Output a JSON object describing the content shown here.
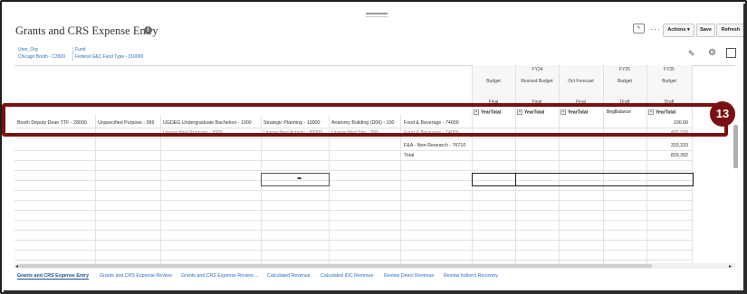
{
  "title": "Grants and CRS Expense Entry",
  "toolbar": {
    "actions_label": "Actions ▾",
    "save_label": "Save",
    "refresh_label": "Refresh"
  },
  "pov": [
    {
      "label": "User_Org",
      "value": "Chicago Booth - C3500"
    },
    {
      "label": "Fund",
      "value": "Federal G&C Fund Type - 310000"
    }
  ],
  "grid": {
    "columns": [
      {
        "period": "",
        "scenario": "Budget",
        "version": "Final",
        "member": "YearTotal"
      },
      {
        "period": "FY24",
        "scenario": "Revised Budget",
        "version": "Final",
        "member": "YearTotal"
      },
      {
        "period": "",
        "scenario": "Oct Forecast",
        "version": "Final",
        "member": "YearTotal"
      },
      {
        "period": "FY25",
        "scenario": "Budget",
        "version": "Draft",
        "member": "BegBalance"
      },
      {
        "period": "FY25",
        "scenario": "Budget",
        "version": "Draft",
        "member": "YearTotal"
      }
    ],
    "highlight_row": {
      "cells": [
        "Booth Deputy Dean TTF - 28000",
        "Unspecified Purpose - 999",
        "UGDEG Undergraduate Bachelors - 1000",
        "Strategic Planning - 10000",
        "Anatomy Building (D06) - 100",
        "Food & Beverage - 74000"
      ],
      "value": "100.00"
    },
    "partial_row": {
      "cells": [
        "",
        "Unspecified Program - 9999",
        "",
        "Unspecified Activity - 99999",
        "Unspecified Site - 999",
        "Food & Beverage - 74000"
      ],
      "value": "495,999"
    },
    "rows": [
      {
        "label": "F&A - Non-Research - 76710",
        "value": "333,333"
      },
      {
        "label": "Total",
        "value": "829,392"
      }
    ]
  },
  "callout_number": "13",
  "tabs": [
    "Grants and CRS Expense Entry",
    "Grants and CRS Expense Review",
    "Grants and CRS Expense Review ...",
    "Calculated Revenue",
    "Calculated IDC Revenue",
    "Review Direct Revenue",
    "Review Indirect Recovery"
  ]
}
